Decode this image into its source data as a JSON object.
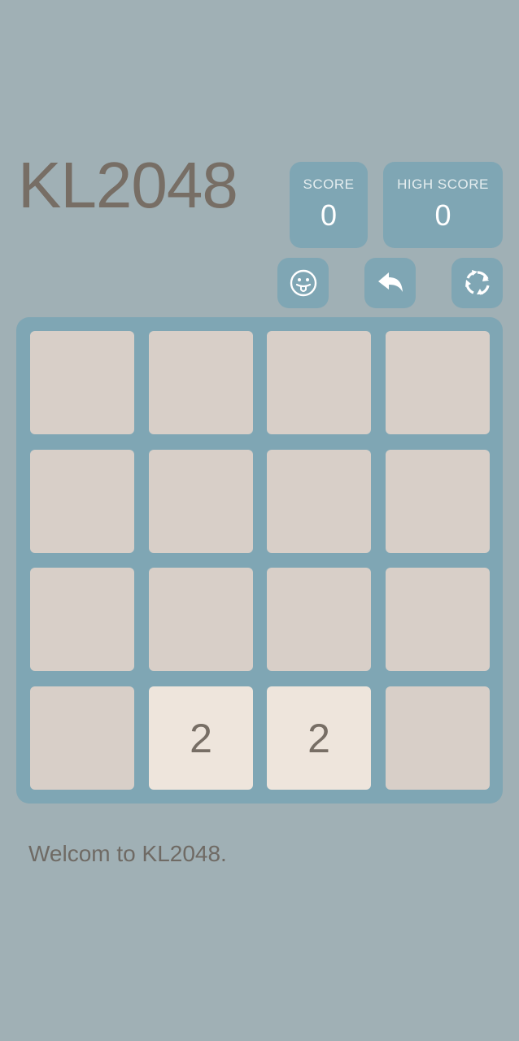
{
  "app": {
    "title": "KL2048"
  },
  "scores": {
    "score_label": "SCORE",
    "score_value": "0",
    "high_score_label": "HIGH SCORE",
    "high_score_value": "0"
  },
  "controls": {
    "emoji_icon": "tongue-out-smiley-icon",
    "undo_icon": "undo-arrow-icon",
    "restart_icon": "restart-cycle-icon"
  },
  "board": {
    "rows": [
      [
        "",
        "",
        "",
        ""
      ],
      [
        "",
        "",
        "",
        ""
      ],
      [
        "",
        "",
        "",
        ""
      ],
      [
        "",
        "2",
        "2",
        ""
      ]
    ]
  },
  "message": "Welcom to KL2048.",
  "colors": {
    "background": "#a0b0b5",
    "board": "#7fa6b4",
    "empty_tile": "#d8cfc8",
    "tile_2": "#eee5dc",
    "text": "#776e65"
  }
}
